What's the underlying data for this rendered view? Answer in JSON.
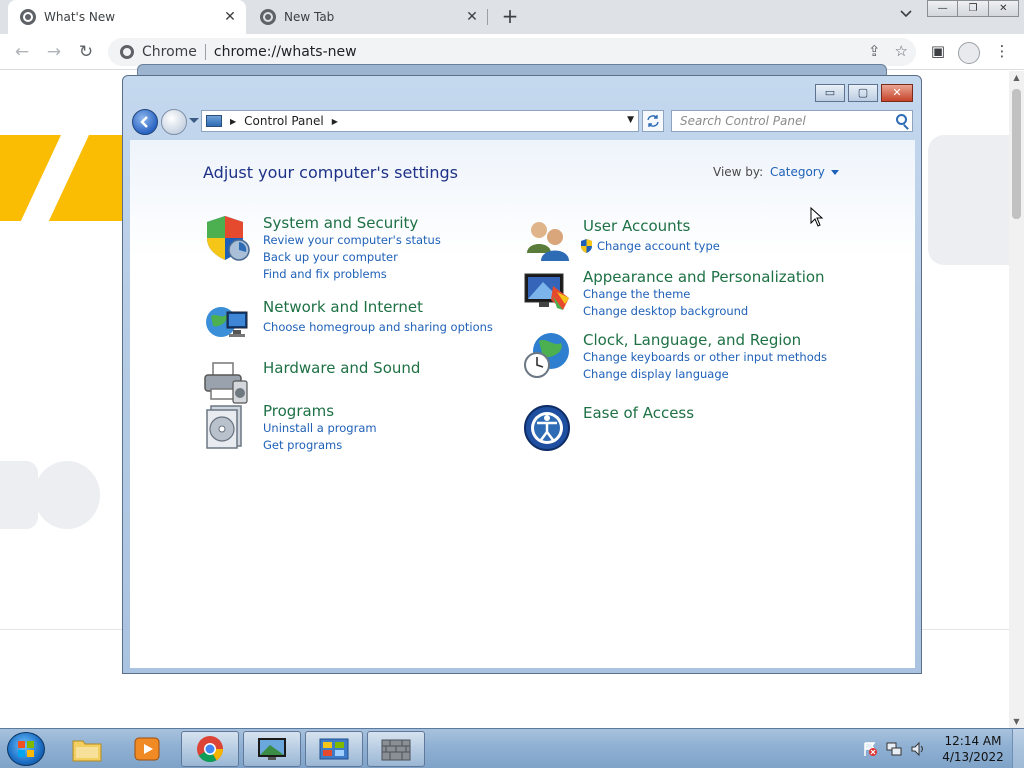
{
  "browser": {
    "tabs": [
      {
        "title": "What's New",
        "close": "✕"
      },
      {
        "title": "New Tab",
        "close": "✕"
      }
    ],
    "new_tab": "+",
    "tabs_menu": "⌄",
    "window_controls": [
      "—",
      "❐",
      "✕"
    ],
    "nav": {
      "back": "←",
      "forward": "→",
      "reload": "↻"
    },
    "address": {
      "chip": "Chrome",
      "url": "chrome://whats-new"
    },
    "toolbar_icons": {
      "share": "⇪",
      "bookmark": "☆",
      "side_panel": "▣",
      "menu": "⋮"
    },
    "scroll_up": "▲",
    "scroll_down": "▼"
  },
  "control_panel": {
    "window_buttons": [
      "▭",
      "▢",
      "✕"
    ],
    "breadcrumb": "Control Panel",
    "search_placeholder": "Search Control Panel",
    "heading": "Adjust your computer's settings",
    "view_by_label": "View by:",
    "view_by_value": "Category",
    "left_categories": [
      {
        "title": "System and Security",
        "links": [
          "Review your computer's status",
          "Back up your computer",
          "Find and fix problems"
        ],
        "icon": "shield-icon"
      },
      {
        "title": "Network and Internet",
        "links": [
          "Choose homegroup and sharing options"
        ],
        "icon": "network-icon"
      },
      {
        "title": "Hardware and Sound",
        "links": [],
        "icon": "printer-icon"
      },
      {
        "title": "Programs",
        "links": [
          "Uninstall a program",
          "Get programs"
        ],
        "icon": "programs-icon"
      }
    ],
    "right_categories": [
      {
        "title": "User Accounts",
        "links": [
          "Change account type"
        ],
        "icon": "users-icon"
      },
      {
        "title": "Appearance and Personalization",
        "links": [
          "Change the theme",
          "Change desktop background"
        ],
        "icon": "monitor-icon"
      },
      {
        "title": "Clock, Language, and Region",
        "links": [
          "Change keyboards or other input methods",
          "Change display language"
        ],
        "icon": "globe-clock-icon"
      },
      {
        "title": "Ease of Access",
        "links": [],
        "icon": "ease-of-access-icon"
      }
    ]
  },
  "taskbar": {
    "items": [
      "explorer",
      "media-player",
      "chrome",
      "remote-desktop",
      "control-panel",
      "firewall"
    ],
    "time": "12:14 AM",
    "date": "4/13/2022"
  }
}
